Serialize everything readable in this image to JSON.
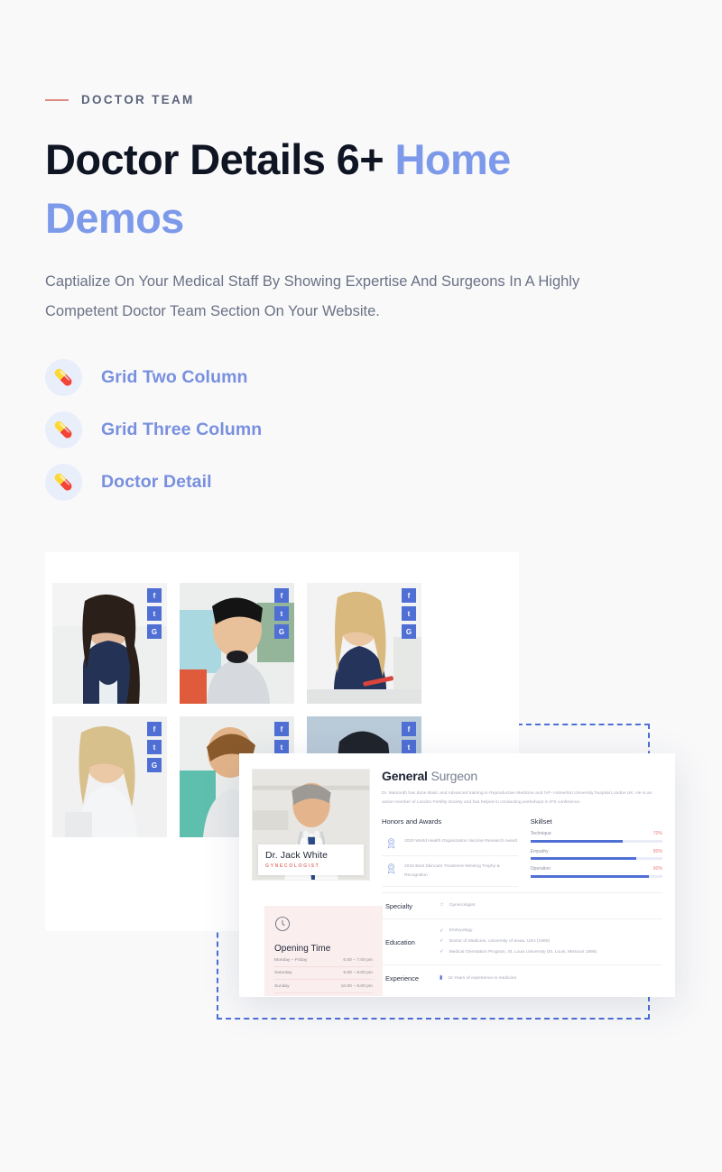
{
  "eyebrow": {
    "label": "DOCTOR TEAM",
    "dash_color": "#dd8b82"
  },
  "heading": {
    "main": "Doctor Details 6+ ",
    "accent": "Home Demos"
  },
  "lede": "Captialize On Your Medical Staff By Showing Expertise And Surgeons In A Highly Competent Doctor Team Section On Your Website.",
  "demo_links": [
    {
      "icon": "pill-icon",
      "glyph": "💊",
      "label": "Grid Two Column"
    },
    {
      "icon": "pill-icon",
      "glyph": "💊",
      "label": "Grid Three Column"
    },
    {
      "icon": "pill-icon",
      "glyph": "💊",
      "label": "Doctor Detail"
    }
  ],
  "colors": {
    "accent_blue": "#7d9aea",
    "link_blue": "#7890df",
    "social_blue": "#4f6fd4",
    "salmon": "#dd8b82",
    "page_bg": "#f9f9fa",
    "dashed_border": "#4c6fd6"
  },
  "preview": {
    "socials": [
      "f",
      "t",
      "G"
    ],
    "grid_cards": [
      {
        "alt": "female-doctor-dark-hair"
      },
      {
        "alt": "male-doctor-smiling"
      },
      {
        "alt": "female-doctor-blonde-writing"
      },
      {
        "alt": "female-doctor-blonde-portrait"
      },
      {
        "alt": "male-doctor-examining"
      },
      {
        "alt": "female-doctor-glasses"
      }
    ],
    "detail": {
      "doctor": {
        "name": "Dr. Jack White",
        "role": "GYNECOLOGIST"
      },
      "opening": {
        "icon": "clock-icon",
        "title": "Opening Time",
        "hours": [
          {
            "day": "Monday – Friday",
            "time": "6.00 – 7.00 pm"
          },
          {
            "day": "Saturday",
            "time": "9.00 – 8.00 pm"
          },
          {
            "day": "Sunday",
            "time": "10.00 – 9.00 pm"
          }
        ]
      },
      "title_bold": "General",
      "title_light": " Surgeon",
      "bio": "Dr. Mantooth has done Basic and Advanced training in Reproductive Medicine and IVF- Homerton University hospital London UK. He is an active member of London Fertility Society and has helped in conducting workshops in IFS conference.",
      "honors_heading": "Honors and Awards",
      "honors": [
        "2020 World Health Organization Vaccine Research Award",
        "2016 Best Skincare Treatment Winning Trophy & Recognition"
      ],
      "skillset_heading": "Skillset",
      "skills": [
        {
          "name": "Technique",
          "percent": "70%",
          "value": 70
        },
        {
          "name": "Empathy",
          "percent": "80%",
          "value": 80
        },
        {
          "name": "Operation",
          "percent": "90%",
          "value": 90
        }
      ],
      "specialty_label": "Specialty",
      "specialty_items": [
        "Gynecologist"
      ],
      "education_label": "Education",
      "education_items": [
        "Embryology",
        "Doctor of Medicine, University of texas, USA (1990)",
        "Medical Orientation Program, St. Louis University (St. Louis, Missouri 1996)"
      ],
      "experience_label": "Experience",
      "experience_items": [
        "15 Years of experience in medicine"
      ]
    }
  }
}
